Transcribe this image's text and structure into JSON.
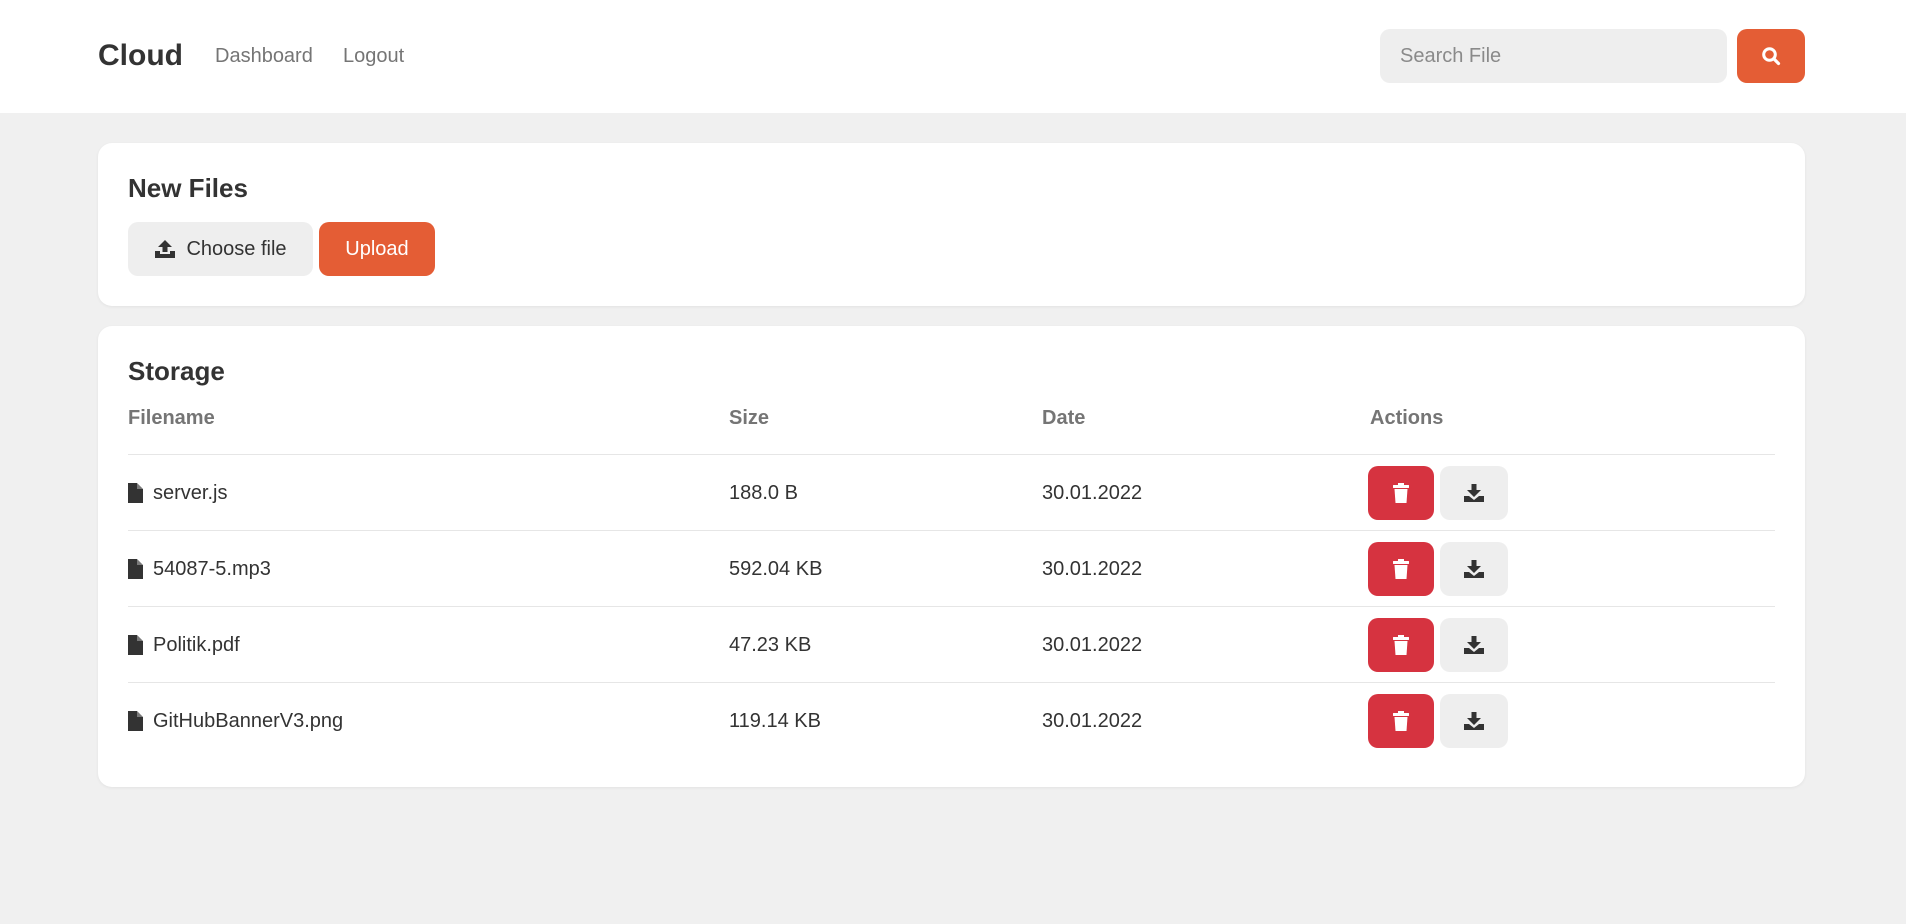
{
  "header": {
    "brand": "Cloud",
    "nav": [
      {
        "label": "Dashboard"
      },
      {
        "label": "Logout"
      }
    ],
    "search": {
      "placeholder": "Search File",
      "value": ""
    }
  },
  "upload_card": {
    "title": "New Files",
    "choose_label": "Choose file",
    "upload_label": "Upload"
  },
  "storage": {
    "title": "Storage",
    "columns": [
      "Filename",
      "Size",
      "Date",
      "Actions"
    ],
    "files": [
      {
        "name": "server.js",
        "size": "188.0 B",
        "date": "30.01.2022"
      },
      {
        "name": "54087-5.mp3",
        "size": "592.04 KB",
        "date": "30.01.2022"
      },
      {
        "name": "Politik.pdf",
        "size": "47.23 KB",
        "date": "30.01.2022"
      },
      {
        "name": "GitHubBannerV3.png",
        "size": "119.14 KB",
        "date": "30.01.2022"
      }
    ]
  },
  "colors": {
    "accent": "#e45d35",
    "danger": "#d63340",
    "background": "#f0f0f0",
    "button_gray": "#eeeeee"
  },
  "icons": {
    "search": "search-icon",
    "upload": "upload-icon",
    "file": "file-icon",
    "delete": "trash-icon",
    "download": "download-icon"
  }
}
